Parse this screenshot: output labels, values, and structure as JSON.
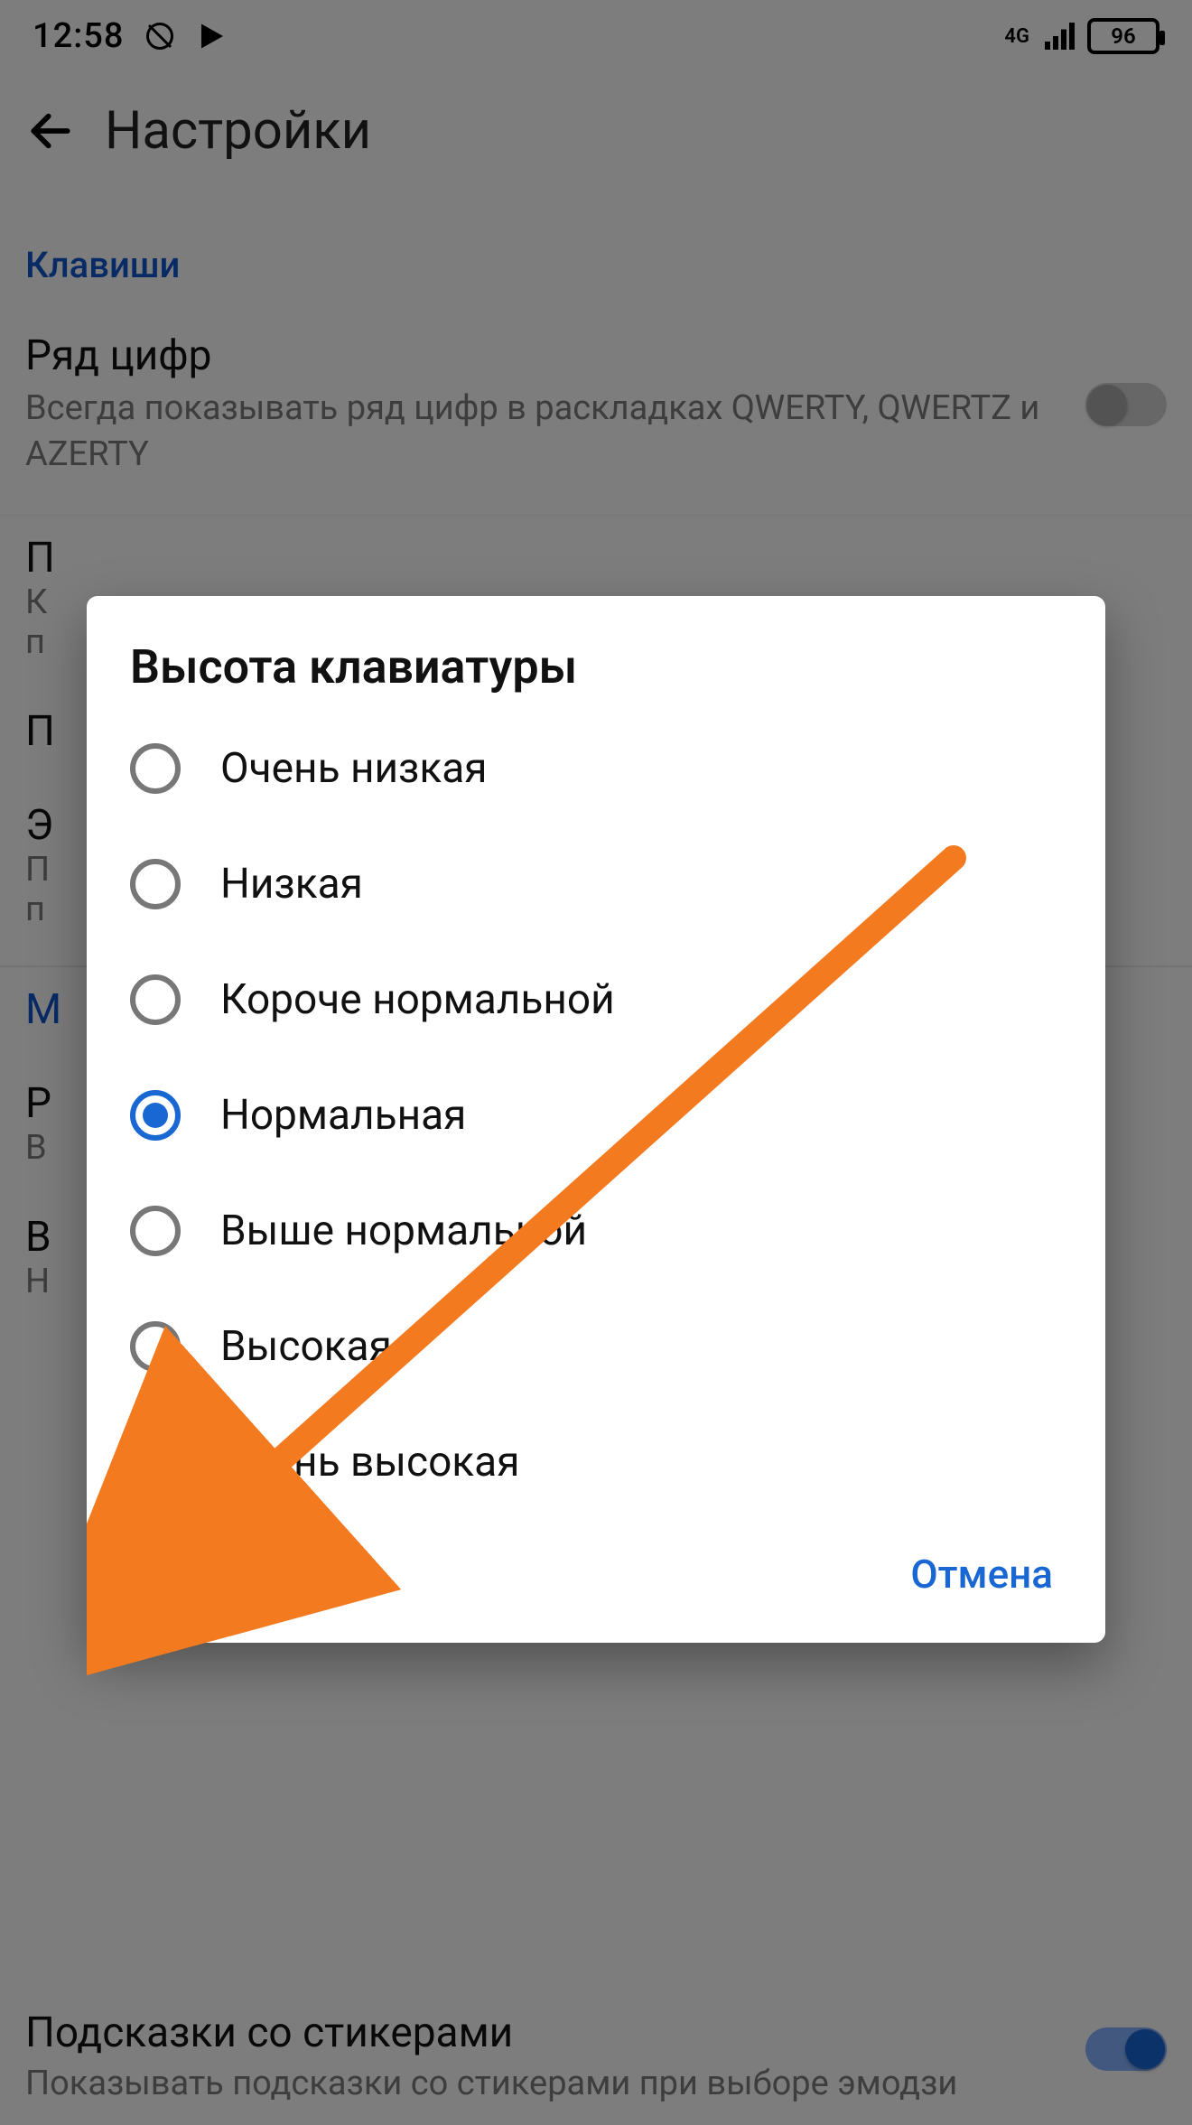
{
  "status": {
    "time": "12:58",
    "signal_label": "4G",
    "battery_percent": "96"
  },
  "toolbar": {
    "title": "Настройки"
  },
  "sections": {
    "keys": {
      "title": "Клавиши",
      "number_row": {
        "title": "Ряд цифр",
        "subtitle": "Всегда показывать ряд цифр в раскладках QWERTY, QWERTZ и AZERTY",
        "enabled": false
      }
    },
    "partial_rows": {
      "row_p1": {
        "letter": "П",
        "sub1": "К",
        "sub2": "п"
      },
      "row_p2": {
        "letter": "П"
      },
      "row_e": {
        "letter": "Э",
        "sub1": "П",
        "sub2": "п"
      },
      "row_m": {
        "letter": "М"
      },
      "row_pb": {
        "letter": "Р",
        "sub": "В"
      },
      "row_v": {
        "letter": "В",
        "sub": "Н"
      }
    },
    "bottom_visible": {
      "title": "Подсказки со стикерами",
      "subtitle": "Показывать подсказки со стикерами при выборе эмодзи",
      "enabled": true
    }
  },
  "dialog": {
    "title": "Высота клавиатуры",
    "options": [
      {
        "label": "Очень низкая",
        "selected": false
      },
      {
        "label": "Низкая",
        "selected": false
      },
      {
        "label": "Короче нормальной",
        "selected": false
      },
      {
        "label": "Нормальная",
        "selected": true
      },
      {
        "label": "Выше нормальной",
        "selected": false
      },
      {
        "label": "Высокая",
        "selected": false
      },
      {
        "label": "Очень высокая",
        "selected": false
      }
    ],
    "cancel": "Отмена"
  },
  "annotation": {
    "arrow_color": "#f47a1f"
  }
}
